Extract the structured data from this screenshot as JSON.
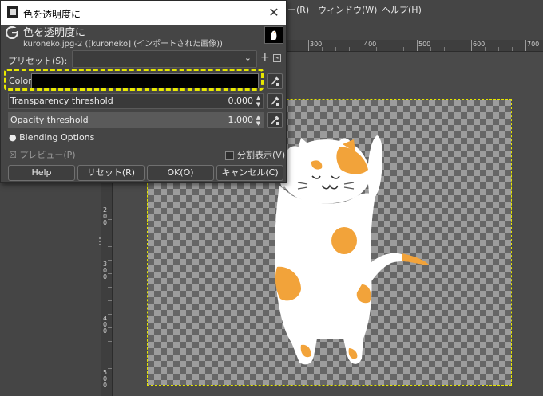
{
  "menubar": {
    "items": [
      "ー(R)",
      "ウィンドウ(W)",
      "ヘルプ(H)"
    ]
  },
  "ruler": {
    "top_labels": [
      "300",
      "400",
      "500",
      "600",
      "700"
    ],
    "left_labels": [
      "200",
      "300",
      "400",
      "500"
    ]
  },
  "dialog": {
    "title": "色を透明度に",
    "close_glyph": "✕",
    "header_title": "色を透明度に",
    "header_subtitle": "kuroneko.jpg-2 ([kuroneko] (インポートされた画像))",
    "preset_label": "プリセット(S):",
    "preset_value": "",
    "color_label": "Color",
    "color_value": "#000000",
    "transparency_label": "Transparency threshold",
    "transparency_value": "0.000",
    "opacity_label": "Opacity threshold",
    "opacity_value": "1.000",
    "blending_label": "Blending Options",
    "preview_label": "プレビュー(P)",
    "split_label": "分割表示(V)",
    "buttons": {
      "help": "Help",
      "reset": "リセット(R)",
      "ok": "OK(O)",
      "cancel": "キャンセル(C)"
    }
  },
  "icons": {
    "eyedropper": "eyedropper-icon",
    "gimp": "gimp-icon",
    "add": "plus-icon",
    "menu": "menu-icon",
    "close": "close-icon"
  },
  "colors": {
    "highlight": "#e8e800",
    "cat_patch": "#f2a33a",
    "cat_body": "#ffffff"
  }
}
